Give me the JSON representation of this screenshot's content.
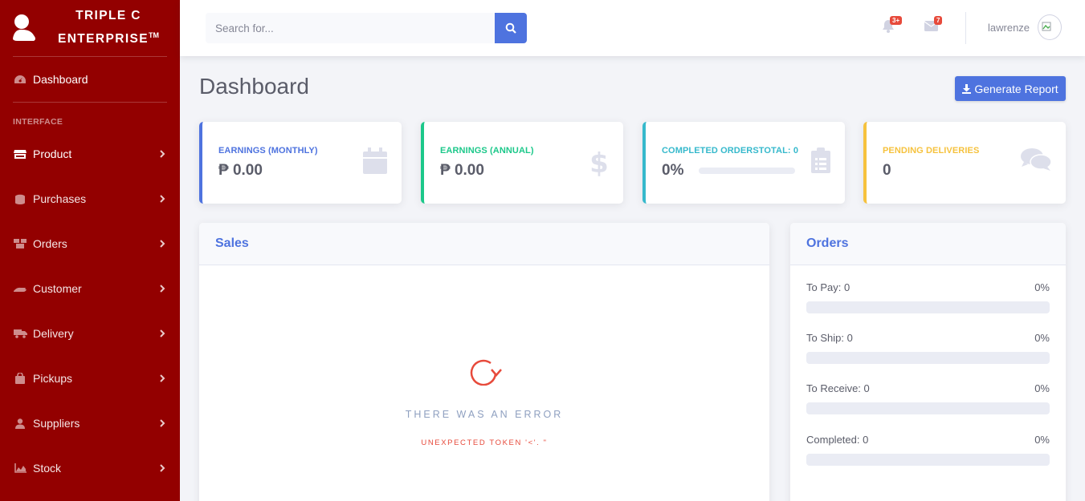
{
  "brand": {
    "line1": "TRIPLE C",
    "line2": "ENTERPRISE",
    "trademark": "TM"
  },
  "sidebar": {
    "dashboard": "Dashboard",
    "heading": "INTERFACE",
    "items": [
      {
        "label": "Product",
        "icon": "store-icon"
      },
      {
        "label": "Purchases",
        "icon": "coins-icon"
      },
      {
        "label": "Orders",
        "icon": "boxes-icon"
      },
      {
        "label": "Customer",
        "icon": "hand-icon"
      },
      {
        "label": "Delivery",
        "icon": "truck-icon"
      },
      {
        "label": "Pickups",
        "icon": "bag-icon"
      },
      {
        "label": "Suppliers",
        "icon": "user-icon"
      },
      {
        "label": "Stock",
        "icon": "area-chart-icon"
      }
    ]
  },
  "topbar": {
    "search_placeholder": "Search for...",
    "alerts_badge": "3+",
    "messages_badge": "7",
    "user_name": "lawrenze"
  },
  "page": {
    "title": "Dashboard",
    "report_button": "Generate Report"
  },
  "cards": {
    "earnings_monthly": {
      "label": "EARNINGS (MONTHLY)",
      "value": "₱ 0.00",
      "color": "#4e73df"
    },
    "earnings_annual": {
      "label": "EARNINGS (ANNUAL)",
      "value": "₱ 0.00",
      "color": "#1cc88a"
    },
    "completed_orders": {
      "label": "COMPLETED ORDERSTOTAL: 0",
      "value": "0%",
      "progress": 0,
      "color": "#36b9cc"
    },
    "pending_deliveries": {
      "label": "PENDING DELIVERIES",
      "value": "0",
      "color": "#f6c23e"
    }
  },
  "sales": {
    "title": "Sales",
    "error_title": "THERE WAS AN ERROR",
    "error_message": "UNEXPECTED TOKEN '<'. \""
  },
  "orders": {
    "title": "Orders",
    "rows": [
      {
        "label": "To Pay: 0",
        "percent": "0%",
        "progress": 0
      },
      {
        "label": "To Ship: 0",
        "percent": "0%",
        "progress": 0
      },
      {
        "label": "To Receive: 0",
        "percent": "0%",
        "progress": 0
      },
      {
        "label": "Completed: 0",
        "percent": "0%",
        "progress": 0
      }
    ]
  },
  "colors": {
    "sidebar": "#930000",
    "primary": "#4e73df",
    "danger": "#e74a3b"
  }
}
